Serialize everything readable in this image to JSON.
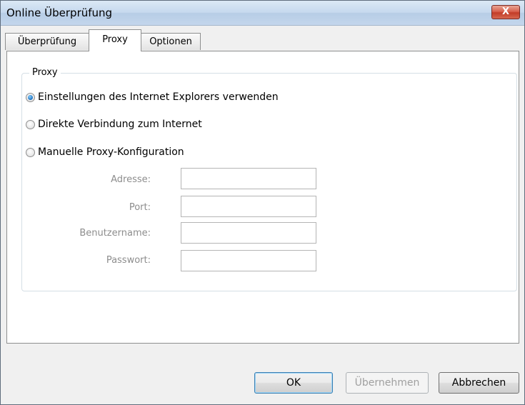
{
  "window": {
    "title": "Online Überprüfung",
    "close_glyph": "X"
  },
  "tabs": [
    {
      "label": "Überprüfung",
      "active": false
    },
    {
      "label": "Proxy",
      "active": true
    },
    {
      "label": "Optionen",
      "active": false
    }
  ],
  "proxy_group": {
    "title": "Proxy",
    "options": [
      {
        "label": "Einstellungen des Internet Explorers verwenden",
        "checked": true
      },
      {
        "label": "Direkte Verbindung zum Internet",
        "checked": false
      },
      {
        "label": "Manuelle Proxy-Konfiguration",
        "checked": false
      }
    ],
    "fields": [
      {
        "label": "Adresse:",
        "value": ""
      },
      {
        "label": "Port:",
        "value": ""
      },
      {
        "label": "Benutzername:",
        "value": ""
      },
      {
        "label": "Passwort:",
        "value": ""
      }
    ]
  },
  "buttons": {
    "ok": "OK",
    "apply": "Übernehmen",
    "cancel": "Abbrechen"
  },
  "colors": {
    "accent": "#1b6fbe",
    "disabled_text": "#8d8d8d",
    "close_button": "#c23c28"
  }
}
